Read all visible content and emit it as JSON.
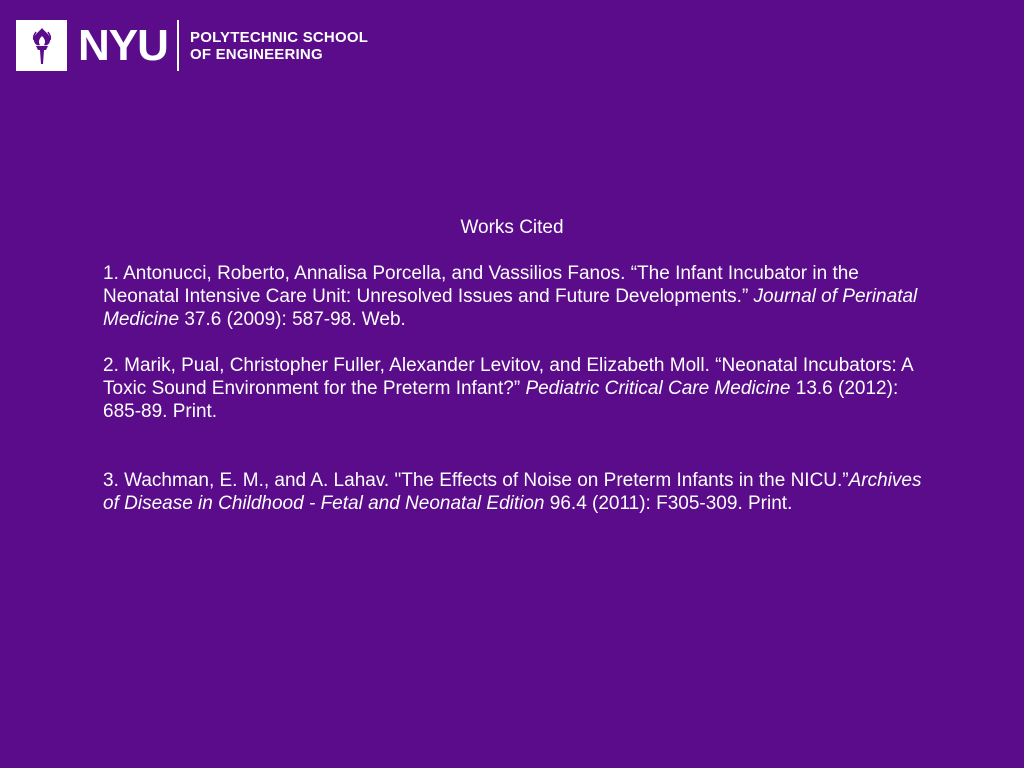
{
  "header": {
    "logo_text": "NYU",
    "school_name_line1": "POLYTECHNIC SCHOOL",
    "school_name_line2": "OF ENGINEERING",
    "torch_icon": "torch-icon"
  },
  "slide": {
    "title": "Works Cited",
    "citations": [
      {
        "before": "1. Antonucci, Roberto, Annalisa Porcella, and Vassilios Fanos. “The Infant Incubator in the Neonatal Intensive Care Unit:     Unresolved Issues and Future Developments.” ",
        "italic": "Journal of Perinatal Medicine",
        "after": " 37.6 (2009): 587-98. Web."
      },
      {
        "before": "2. Marik, Pual, Christopher Fuller, Alexander Levitov, and Elizabeth Moll. “Neonatal Incubators: A Toxic Sound Environment for the Preterm Infant?” ",
        "italic": "Pediatric Critical Care Medicine",
        "after": " 13.6 (2012): 685-89. Print."
      },
      {
        "before": "3. Wachman, E. M., and A. Lahav. \"The Effects of Noise on Preterm Infants in the NICU.”",
        "italic": "Archives of Disease in Childhood - Fetal and Neonatal Edition",
        "after": " 96.4 (2011): F305-309. Print."
      }
    ]
  },
  "colors": {
    "background": "#5a0c8a",
    "text": "#ffffff",
    "logo_box": "#ffffff"
  }
}
